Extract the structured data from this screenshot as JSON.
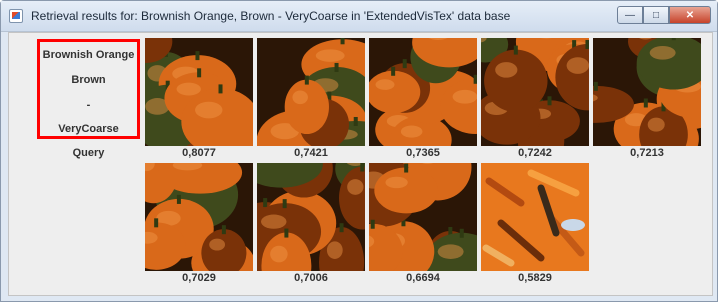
{
  "window": {
    "title": "Retrieval results for: Brownish Orange, Brown - VeryCoarse in 'ExtendedVisTex' data base"
  },
  "query": {
    "lines": [
      "Brownish Orange",
      "Brown",
      "-",
      "VeryCoarse"
    ],
    "label": "Query",
    "highlight_color": "#ff0000"
  },
  "results": [
    {
      "score": "0,8077",
      "kind": "pumpkins"
    },
    {
      "score": "0,7421",
      "kind": "pumpkins"
    },
    {
      "score": "0,7365",
      "kind": "pumpkins"
    },
    {
      "score": "0,7242",
      "kind": "pumpkins"
    },
    {
      "score": "0,7213",
      "kind": "pumpkins"
    },
    {
      "score": "0,7029",
      "kind": "pumpkins"
    },
    {
      "score": "0,7006",
      "kind": "pumpkins"
    },
    {
      "score": "0,6694",
      "kind": "pumpkins"
    },
    {
      "score": "0,5829",
      "kind": "painted-texture"
    }
  ],
  "colors": {
    "pumpkin_orange": "#d9691a",
    "pumpkin_shadow": "#7a3208",
    "stem_green": "#3f4a1c",
    "texture_orange": "#e8781e"
  }
}
